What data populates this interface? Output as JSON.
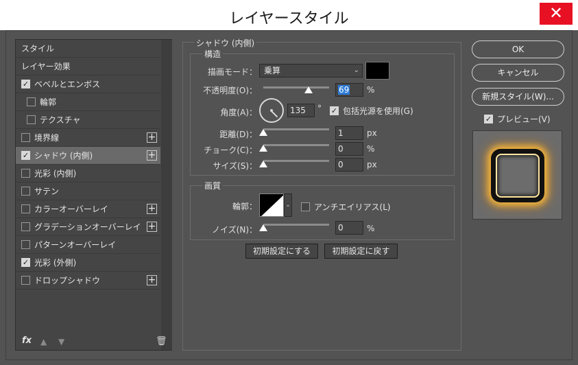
{
  "window": {
    "title": "レイヤースタイル",
    "close_label": "✕"
  },
  "sidebar": {
    "items": [
      {
        "label": "スタイル",
        "checkbox": false,
        "checked": false,
        "plus": false,
        "indent": false,
        "selected": false
      },
      {
        "label": "レイヤー効果",
        "checkbox": false,
        "checked": false,
        "plus": false,
        "indent": false,
        "selected": false
      },
      {
        "label": "ベベルとエンボス",
        "checkbox": true,
        "checked": true,
        "plus": false,
        "indent": false,
        "selected": false
      },
      {
        "label": "輪郭",
        "checkbox": true,
        "checked": false,
        "plus": false,
        "indent": true,
        "selected": false
      },
      {
        "label": "テクスチャ",
        "checkbox": true,
        "checked": false,
        "plus": false,
        "indent": true,
        "selected": false
      },
      {
        "label": "境界線",
        "checkbox": true,
        "checked": false,
        "plus": true,
        "indent": false,
        "selected": false
      },
      {
        "label": "シャドウ (内側)",
        "checkbox": true,
        "checked": true,
        "plus": true,
        "indent": false,
        "selected": true
      },
      {
        "label": "光彩 (内側)",
        "checkbox": true,
        "checked": false,
        "plus": false,
        "indent": false,
        "selected": false
      },
      {
        "label": "サテン",
        "checkbox": true,
        "checked": false,
        "plus": false,
        "indent": false,
        "selected": false
      },
      {
        "label": "カラーオーバーレイ",
        "checkbox": true,
        "checked": false,
        "plus": true,
        "indent": false,
        "selected": false
      },
      {
        "label": "グラデーションオーバーレイ",
        "checkbox": true,
        "checked": false,
        "plus": true,
        "indent": false,
        "selected": false
      },
      {
        "label": "パターンオーバーレイ",
        "checkbox": true,
        "checked": false,
        "plus": false,
        "indent": false,
        "selected": false
      },
      {
        "label": "光彩 (外側)",
        "checkbox": true,
        "checked": true,
        "plus": false,
        "indent": false,
        "selected": false
      },
      {
        "label": "ドロップシャドウ",
        "checkbox": true,
        "checked": false,
        "plus": true,
        "indent": false,
        "selected": false
      }
    ],
    "fx_label": "fx",
    "plus_glyph": "+",
    "check_glyph": "✓"
  },
  "panel": {
    "section_title": "シャドウ (内側)",
    "structure": {
      "title": "構造",
      "blend_mode_label": "描画モード：",
      "blend_mode_value": "乗算",
      "color": "#000000",
      "opacity_label": "不透明度(O)：",
      "opacity_value": "69",
      "opacity_unit": "%",
      "opacity_level": 69,
      "angle_label": "角度(A)：",
      "angle_value": "135",
      "angle_unit": "°",
      "global_light_label": "包括光源を使用(G)",
      "global_light_checked": true,
      "distance_label": "距離(D)：",
      "distance_value": "1",
      "distance_unit": "px",
      "choke_label": "チョーク(C)：",
      "choke_value": "0",
      "choke_unit": "%",
      "size_label": "サイズ(S)：",
      "size_value": "0",
      "size_unit": "px"
    },
    "quality": {
      "title": "画質",
      "contour_label": "輪郭：",
      "antialias_label": "アンチエイリアス(L)",
      "antialias_checked": false,
      "noise_label": "ノイズ(N)：",
      "noise_value": "0",
      "noise_unit": "%"
    },
    "make_default_label": "初期設定にする",
    "reset_default_label": "初期設定に戻す"
  },
  "actions": {
    "ok_label": "OK",
    "cancel_label": "キャンセル",
    "new_style_label": "新規スタイル(W)...",
    "preview_label": "プレビュー(V)",
    "preview_checked": true
  },
  "colors": {
    "accent": "#2d7bd8",
    "close": "#e81123",
    "glow": "#ffbe3c"
  }
}
